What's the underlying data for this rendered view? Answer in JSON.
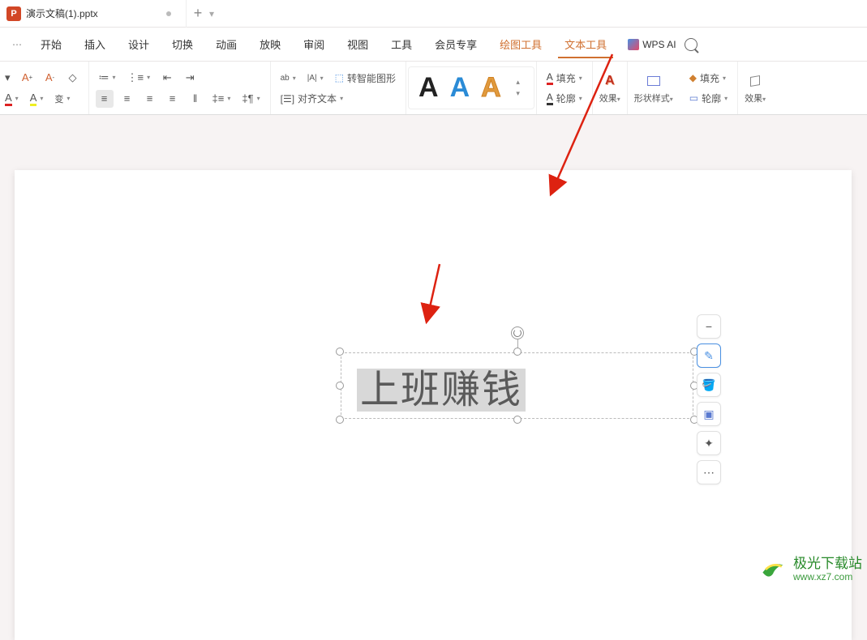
{
  "document": {
    "title": "演示文稿(1).pptx"
  },
  "menu": {
    "items": [
      {
        "label": "开始",
        "key": "start"
      },
      {
        "label": "插入",
        "key": "insert"
      },
      {
        "label": "设计",
        "key": "design"
      },
      {
        "label": "切换",
        "key": "transition"
      },
      {
        "label": "动画",
        "key": "animation"
      },
      {
        "label": "放映",
        "key": "slideshow"
      },
      {
        "label": "审阅",
        "key": "review"
      },
      {
        "label": "视图",
        "key": "view"
      },
      {
        "label": "工具",
        "key": "tools"
      },
      {
        "label": "会员专享",
        "key": "vip"
      },
      {
        "label": "绘图工具",
        "key": "draw-tools",
        "orange": true
      },
      {
        "label": "文本工具",
        "key": "text-tools",
        "orange": true,
        "underline": true
      }
    ],
    "wps_ai": "WPS AI"
  },
  "ribbon": {
    "font_grow": "A+",
    "font_shrink": "A-",
    "clear_format": "◇",
    "font_color": "A",
    "highlight": "A",
    "pinyin": "变",
    "bullets": "≡",
    "numbering": "≡",
    "indent_dec": "≣",
    "indent_inc": "≣",
    "align_left": "≡",
    "align_center": "≡",
    "align_right": "≡",
    "align_justify": "≡",
    "tab_left": "||",
    "line_spacing": "↕",
    "para_spacing": "¶↕",
    "text_dir": "ab",
    "char_scale": "|A|",
    "convert_smart": "转智能图形",
    "align_text": "对齐文本",
    "fill_label": "填充",
    "outline_label": "轮廓",
    "effects_label": "效果",
    "shape_style_label": "形状样式",
    "shape_fill_label": "填充",
    "shape_outline_label": "轮廓",
    "shape_effects_label": "效果"
  },
  "textbox": {
    "content": "上班赚钱"
  },
  "side_tools": [
    "minus",
    "pencil",
    "bucket",
    "shadow",
    "sparkle",
    "dots"
  ],
  "watermark": {
    "site_name": "极光下载站",
    "url": "www.xz7.com"
  }
}
